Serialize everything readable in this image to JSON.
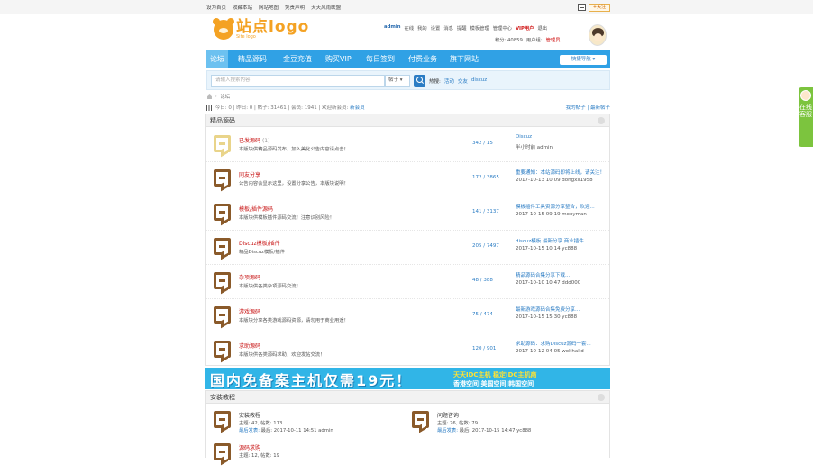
{
  "topbar": {
    "links": [
      "设为首页",
      "收藏本站",
      "网站地图",
      "免责声明",
      "天天风雨联盟"
    ],
    "fav": "+关注"
  },
  "logo": {
    "text": "站点logo",
    "sub": "Site logo"
  },
  "user": {
    "name": "admin",
    "online": "在线",
    "items": [
      "我的",
      "设置",
      "消息",
      "提醒",
      "模板管理",
      "管理中心"
    ],
    "vip": "VIP用户",
    "logout": "退出",
    "points": "积分: 40859",
    "group_label": "用户组:",
    "group": "管理员"
  },
  "nav": {
    "items": [
      "论坛",
      "精品源码",
      "金豆充值",
      "购买VIP",
      "每日签到",
      "付费业务",
      "旗下网站"
    ],
    "quick": "快捷导航 ▾"
  },
  "search": {
    "placeholder": "请输入搜索内容",
    "scope": "帖子 ▾",
    "hot_label": "热搜:",
    "hot": [
      "活动",
      "交友",
      "discuz"
    ]
  },
  "breadcrumb": {
    "sep": "›",
    "current": "论坛"
  },
  "stats": {
    "text": "今日: 0 | 昨日: 0 | 帖子: 31461 | 会员: 1941 | 欢迎新会员:",
    "new_member": "新会员",
    "right": "我的帖子 | 最新帖子"
  },
  "section1": {
    "title": "精品源码",
    "forums": [
      {
        "title": "已发源码",
        "count": "(1)",
        "desc": "本版块供精品源码发布，加入美化公告内容请点击！",
        "num": "342 / 15",
        "last": "Discuz",
        "last_meta": "半小时前 admin"
      },
      {
        "title": "同友分享",
        "count": "",
        "desc": "公告内容会显示这里，设置分享公告，本版块说明！",
        "num": "172 / 3865",
        "last": "重要通知：本站源码即将上线，请关注！",
        "last_meta": "2017-10-13 10:09 dongxx1958"
      },
      {
        "title": "模板/插件源码",
        "count": "",
        "desc": "本版块供模板插件源码交流！注意识别风险！",
        "num": "141 / 3137",
        "last": "模板插件工具资源分享整合，欢迎...",
        "last_meta": "2017-10-15 09:19 mooyman"
      },
      {
        "title": "Discuz模板/插件",
        "count": "",
        "desc": "精品Discuz模板/插件",
        "num": "205 / 7497",
        "last": "discuz模板 最新分享 商业插件",
        "last_meta": "2017-10-15 10:14 yc888"
      },
      {
        "title": "杂项源码",
        "count": "",
        "desc": "本版块供各类杂项源码交流！",
        "num": "48 / 388",
        "last": "精品源码合集分享下载...",
        "last_meta": "2017-10-10 10:47 ddd000"
      },
      {
        "title": "游戏源码",
        "count": "",
        "desc": "本版块分享各类游戏源码资源，请勿用于商业用途！",
        "num": "75 / 474",
        "last": "最新游戏源码合集免费分享...",
        "last_meta": "2017-10-15 15:30 yc888"
      },
      {
        "title": "求助源码",
        "count": "",
        "desc": "本版块供各类源码求助，欢迎发帖交流！",
        "num": "120 / 901",
        "last": "求助源码：求购Discuz源码一套...",
        "last_meta": "2017-10-12 04:05 wokhalid"
      }
    ]
  },
  "banner": {
    "big": "国内免备案主机仅需19元！",
    "s1": "天天IDC主机 稳定IDC主机商",
    "s2": "香港空间|美国空间|韩国空间"
  },
  "section2": {
    "title": "安装教程",
    "forums": [
      {
        "title": "安装教程",
        "meta": "主题: 42, 帖数: 113",
        "last_link": "最后发表:",
        "last": "最后: 2017-10-11 14:51 admin"
      },
      {
        "title": "问题咨询",
        "meta": "主题: 76, 帖数: 79",
        "last_link": "最后发表:",
        "last": "最后: 2017-10-15 14:47 yc888"
      },
      {
        "title": "源码求购",
        "meta": "主题: 12, 帖数: 19",
        "last_link": "",
        "last": ""
      }
    ]
  },
  "side": {
    "label": "在线客服"
  }
}
